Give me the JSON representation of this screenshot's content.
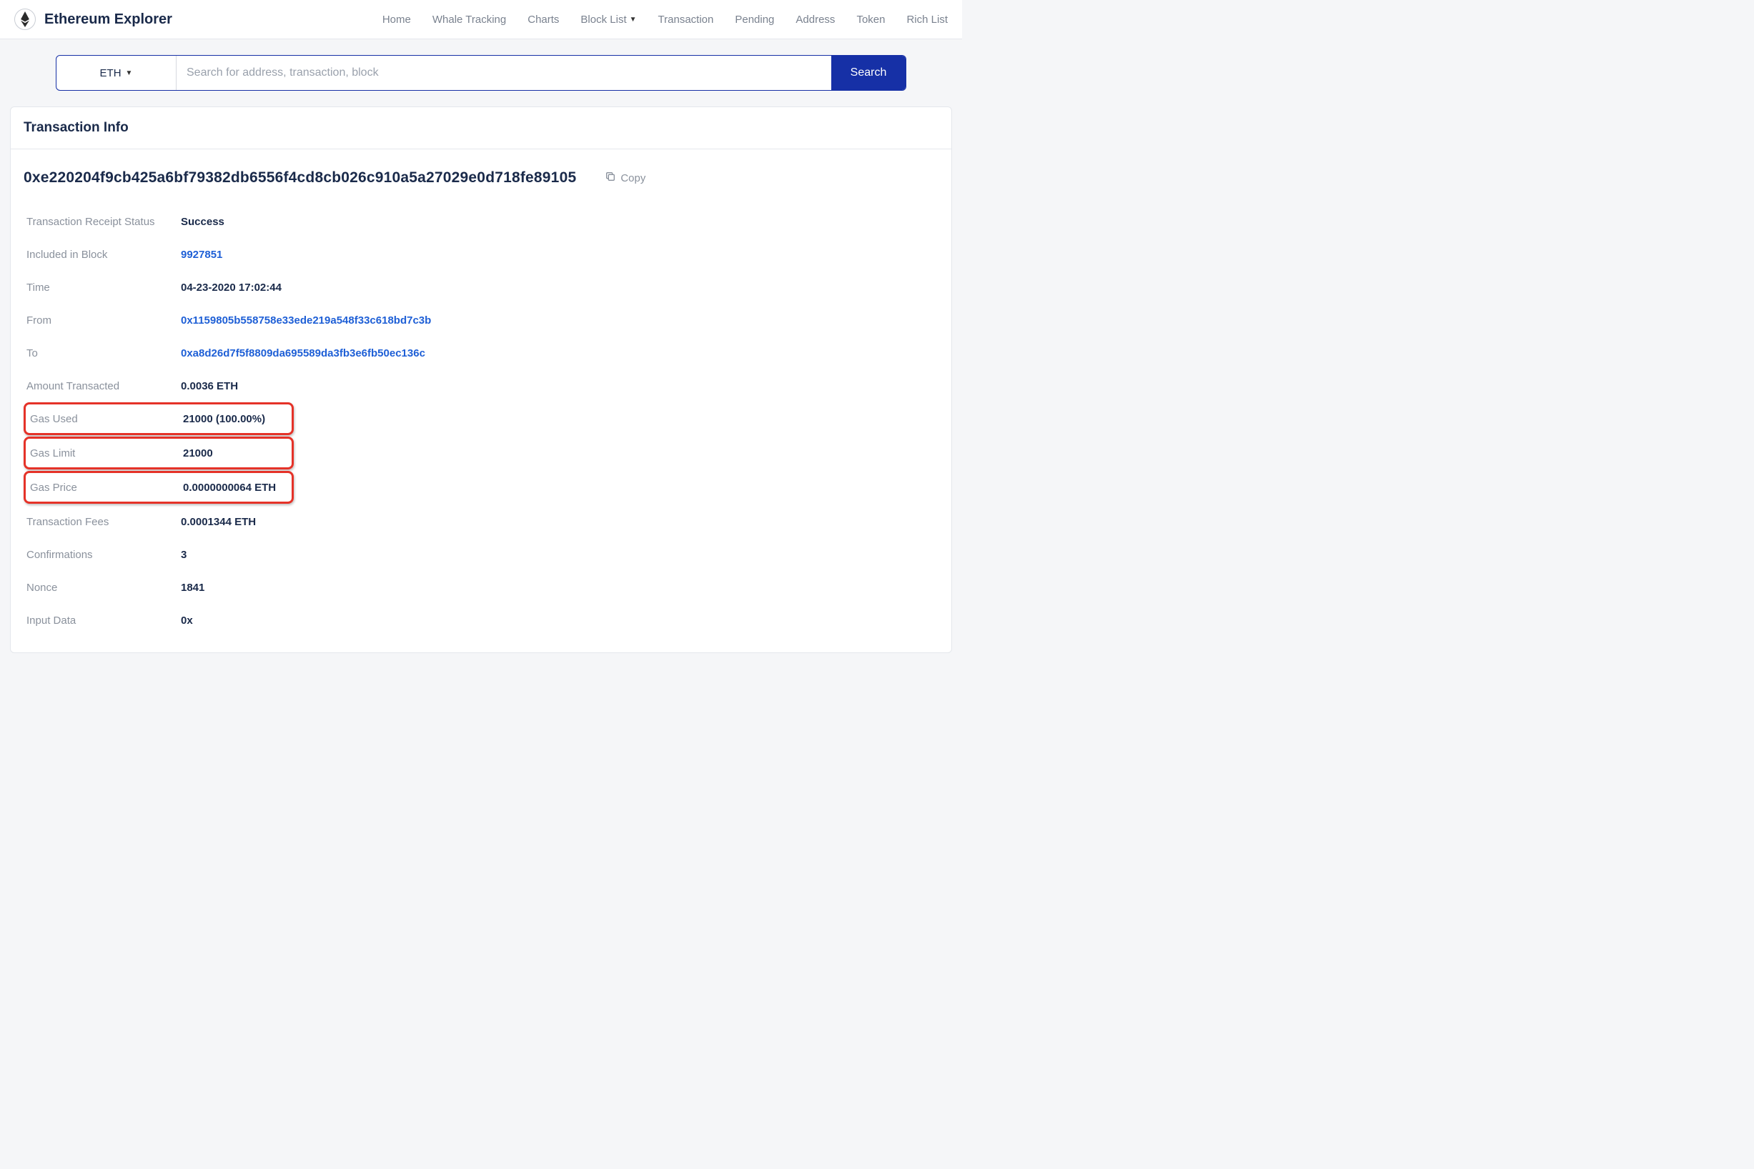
{
  "header": {
    "brand": "Ethereum Explorer",
    "nav": {
      "home": "Home",
      "whale": "Whale Tracking",
      "charts": "Charts",
      "block_list": "Block List",
      "transaction": "Transaction",
      "pending": "Pending",
      "address": "Address",
      "token": "Token",
      "rich_list": "Rich List"
    }
  },
  "search": {
    "coin": "ETH",
    "placeholder": "Search for address, transaction, block",
    "button": "Search"
  },
  "card": {
    "title": "Transaction Info",
    "hash": "0xe220204f9cb425a6bf79382db6556f4cd8cb026c910a5a27029e0d718fe89105",
    "copy_label": "Copy"
  },
  "details": {
    "status_label": "Transaction Receipt Status",
    "status_value": "Success",
    "block_label": "Included in Block",
    "block_value": "9927851",
    "time_label": "Time",
    "time_value": "04-23-2020 17:02:44",
    "from_label": "From",
    "from_value": "0x1159805b558758e33ede219a548f33c618bd7c3b",
    "to_label": "To",
    "to_value": "0xa8d26d7f5f8809da695589da3fb3e6fb50ec136c",
    "amount_label": "Amount Transacted",
    "amount_value": "0.0036 ETH",
    "gas_used_label": "Gas Used",
    "gas_used_value": "21000 (100.00%)",
    "gas_limit_label": "Gas Limit",
    "gas_limit_value": "21000",
    "gas_price_label": "Gas Price",
    "gas_price_value": "0.0000000064 ETH",
    "fees_label": "Transaction Fees",
    "fees_value": "0.0001344 ETH",
    "confirmations_label": "Confirmations",
    "confirmations_value": "3",
    "nonce_label": "Nonce",
    "nonce_value": "1841",
    "input_label": "Input Data",
    "input_value": "0x"
  }
}
